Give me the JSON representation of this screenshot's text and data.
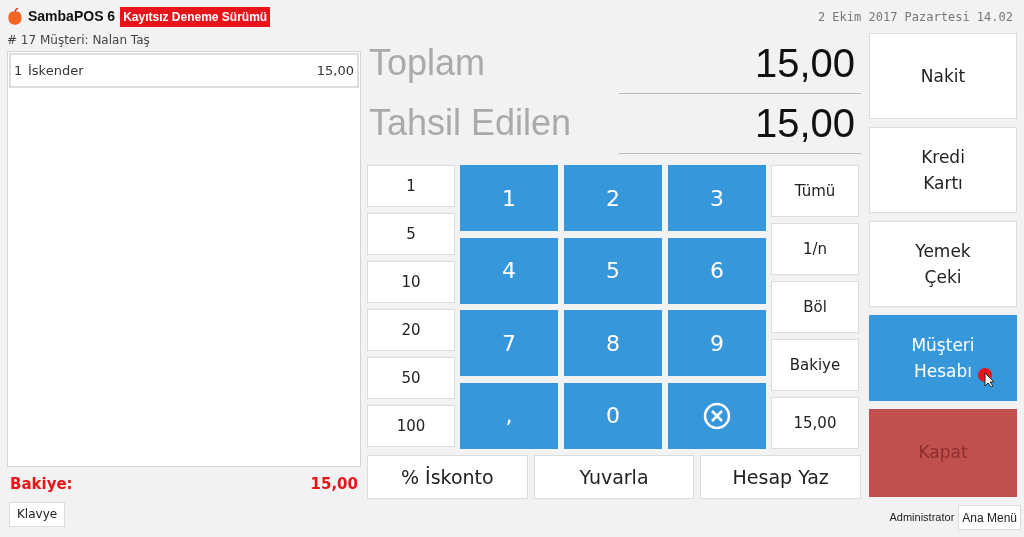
{
  "header": {
    "app_name": "SambaPOS 6",
    "badge": "Kayıtsız Deneme Sürümü",
    "datetime": "2 Ekim 2017 Pazartesi 14.02"
  },
  "ticket": {
    "title": "# 17 Müşteri: Nalan Taş",
    "items": [
      {
        "qty": "1",
        "name": "İskender",
        "price": "15,00"
      }
    ],
    "balance_label": "Bakiye:",
    "balance_value": "15,00",
    "keyboard_button": "Klavye"
  },
  "totals": [
    {
      "label": "Toplam",
      "value": "15,00"
    },
    {
      "label": "Tahsil Edilen",
      "value": "15,00"
    }
  ],
  "quick_amounts": [
    "1",
    "5",
    "10",
    "20",
    "50",
    "100"
  ],
  "keys": [
    {
      "kind": "digit",
      "label": "1"
    },
    {
      "kind": "digit",
      "label": "2"
    },
    {
      "kind": "digit",
      "label": "3"
    },
    {
      "kind": "digit",
      "label": "4"
    },
    {
      "kind": "digit",
      "label": "5"
    },
    {
      "kind": "digit",
      "label": "6"
    },
    {
      "kind": "digit",
      "label": "7"
    },
    {
      "kind": "digit",
      "label": "8"
    },
    {
      "kind": "digit",
      "label": "9"
    },
    {
      "kind": "digit",
      "label": ","
    },
    {
      "kind": "digit",
      "label": "0"
    },
    {
      "kind": "clear"
    }
  ],
  "split_buttons": [
    "Tümü",
    "1/n",
    "Böl",
    "Bakiye",
    "15,00"
  ],
  "action_buttons": [
    "% İskonto",
    "Yuvarla",
    "Hesap Yaz"
  ],
  "payments": [
    {
      "label": "Nakit",
      "selected": false
    },
    {
      "label": "Kredi\nKartı",
      "selected": false
    },
    {
      "label": "Yemek\nÇeki",
      "selected": false
    },
    {
      "label": "Müşteri\nHesabı",
      "selected": true
    }
  ],
  "close_button": {
    "label": "Kapat",
    "disabled": true
  },
  "footer": {
    "user": "Administrator",
    "menu_button": "Ana Menü"
  }
}
